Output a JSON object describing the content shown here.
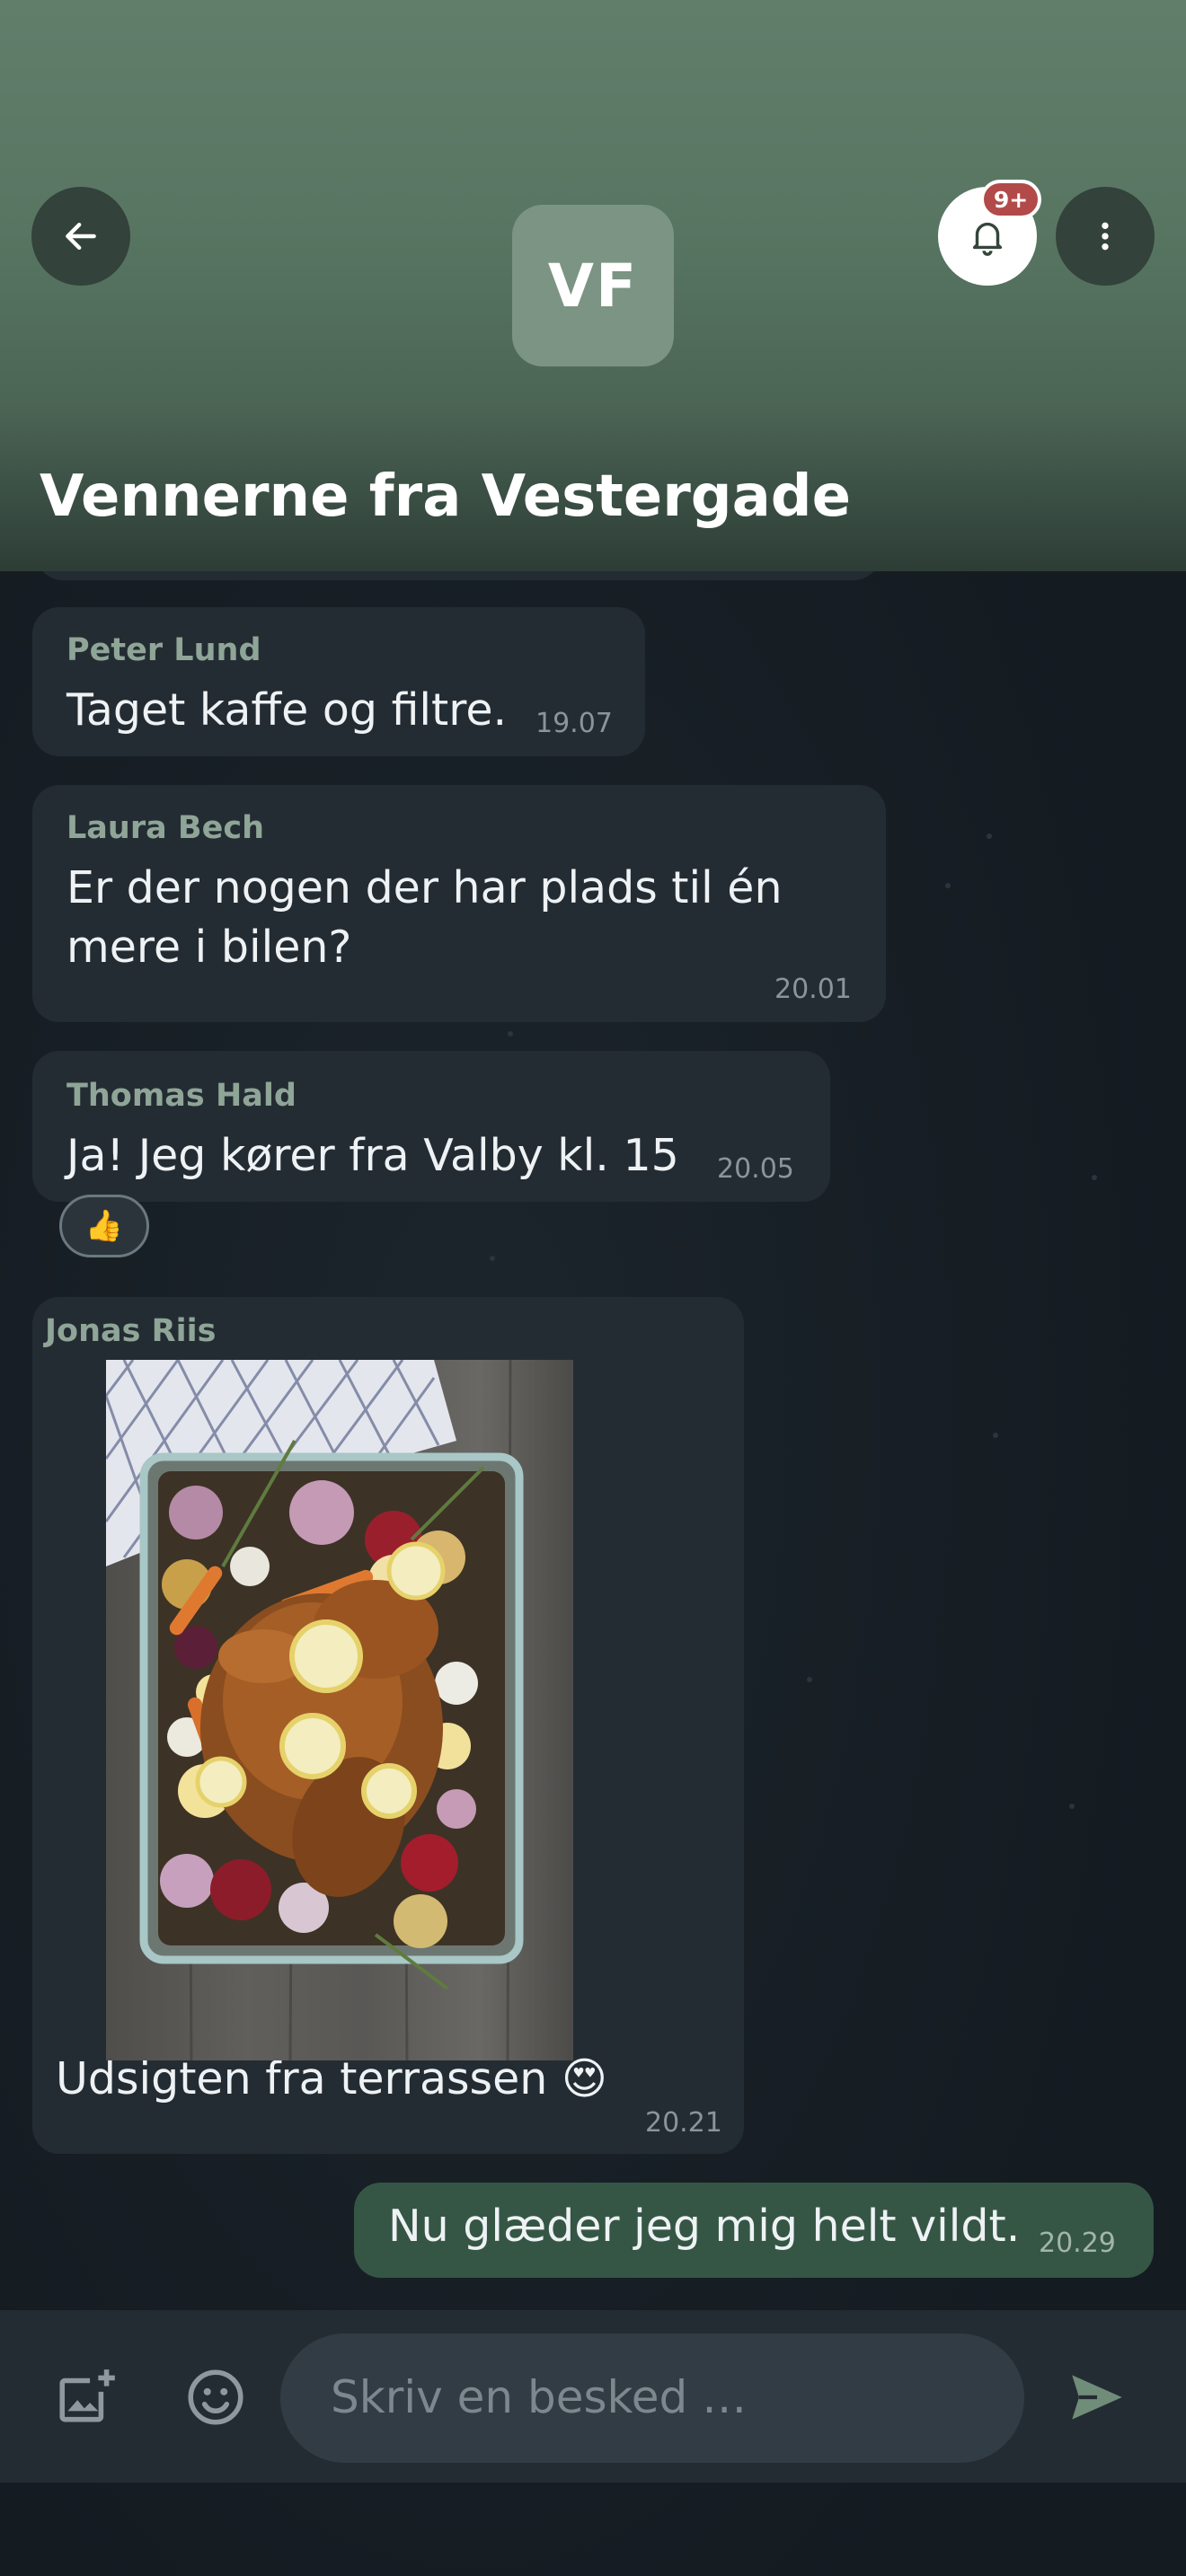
{
  "header": {
    "avatar_initials": "VF",
    "group_name": "Vennerne fra Vestergade",
    "notification_badge": "9+",
    "icons": [
      "back-arrow-icon",
      "bell-icon",
      "more-vertical-icon"
    ]
  },
  "messages": [
    {
      "sender": "Peter Lund",
      "text": "Taget kaffe og filtre.",
      "time": "19.07"
    },
    {
      "sender": "Laura Bech",
      "text_lines": [
        "Er der nogen der har plads til én",
        "mere i bilen?"
      ],
      "time": "20.01"
    },
    {
      "sender": "Thomas Hald",
      "text": "Ja! Jeg kører fra Valby kl. 15",
      "time": "20.05",
      "reaction": "👍"
    },
    {
      "sender": "Jonas Riis",
      "image": "roast-chicken-with-vegetables-photo",
      "text": "Udsigten fra terrassen 😍",
      "time": "20.21"
    },
    {
      "sender": "me",
      "text": "Nu glæder jeg mig helt vildt.",
      "time": "20.29"
    }
  ],
  "composer": {
    "placeholder": "Skriv en besked …",
    "icons": [
      "add-image-icon",
      "emoji-icon",
      "send-icon"
    ]
  },
  "colors": {
    "header_top": "#617e6b",
    "bubble": "#242c33",
    "own_bubble": "#355645",
    "sender_name": "#8fa597",
    "badge": "#b24a4a",
    "send_accent": "#6f8d79"
  }
}
